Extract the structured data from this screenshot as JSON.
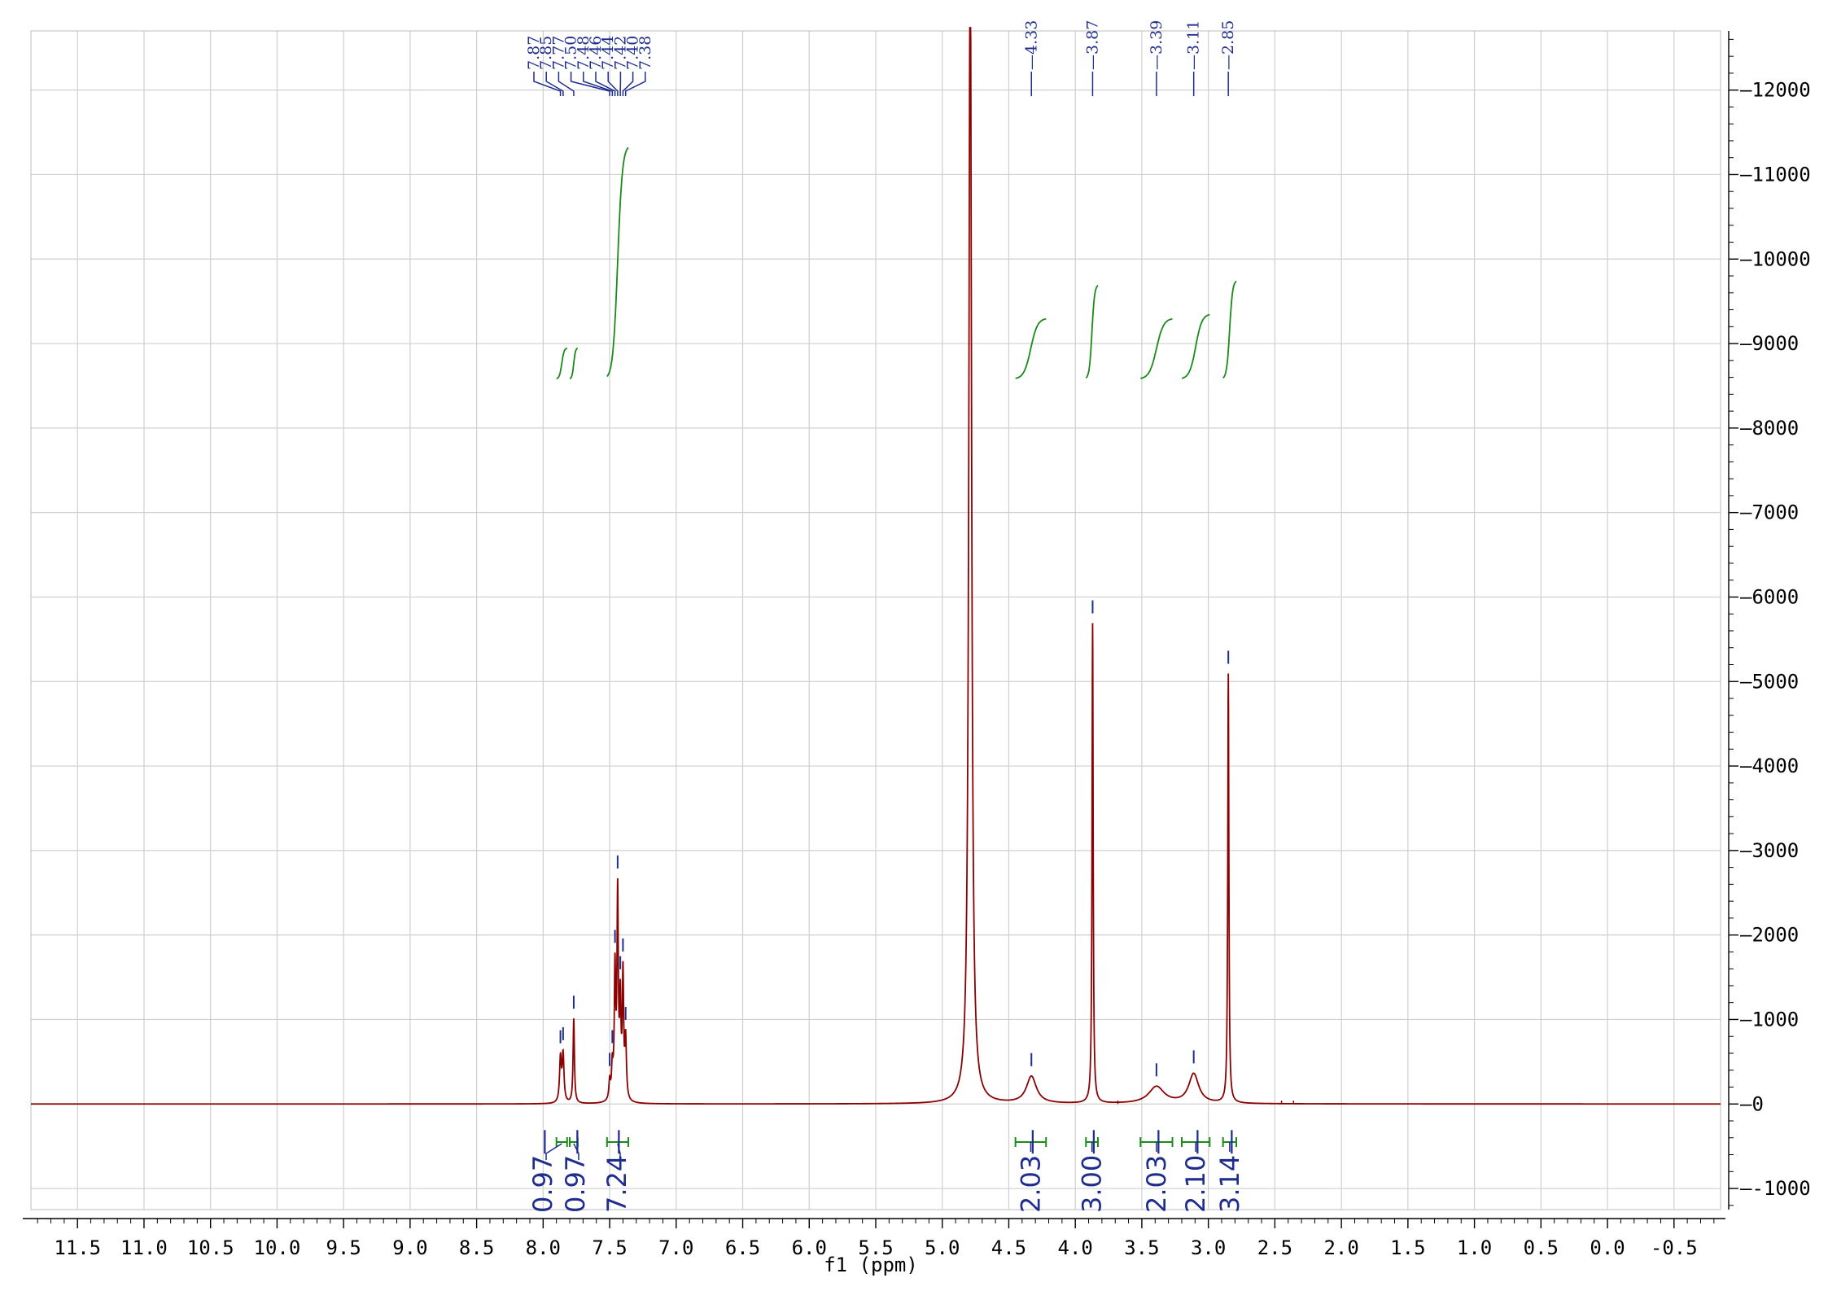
{
  "chart_data": {
    "type": "line",
    "xlabel": "f1 (ppm)",
    "ylabel": "",
    "title": "",
    "xlim": [
      11.85,
      -0.85
    ],
    "ylim": [
      -1250,
      12700
    ],
    "x_reversed": true,
    "grid": true,
    "x_ticks": [
      "11.5",
      "11.0",
      "10.5",
      "10.0",
      "9.5",
      "9.0",
      "8.5",
      "8.0",
      "7.5",
      "7.0",
      "6.5",
      "6.0",
      "5.5",
      "5.0",
      "4.5",
      "4.0",
      "3.5",
      "3.0",
      "2.5",
      "2.0",
      "1.5",
      "1.0",
      "0.5",
      "0.0",
      "-0.5"
    ],
    "y_ticks": [
      "12000",
      "11000",
      "10000",
      "9000",
      "8000",
      "7000",
      "6000",
      "5000",
      "4000",
      "3000",
      "2000",
      "1000",
      "0",
      "-1000"
    ],
    "series": [
      {
        "color": "#8b0000",
        "peaks": [
          {
            "ppm": 7.87,
            "height": 520,
            "width": 0.008
          },
          {
            "ppm": 7.85,
            "height": 560,
            "width": 0.008
          },
          {
            "ppm": 7.77,
            "height": 1000,
            "width": 0.006
          },
          {
            "ppm": 7.5,
            "height": 220,
            "width": 0.007
          },
          {
            "ppm": 7.48,
            "height": 380,
            "width": 0.007
          },
          {
            "ppm": 7.46,
            "height": 1500,
            "width": 0.006
          },
          {
            "ppm": 7.44,
            "height": 2400,
            "width": 0.006
          },
          {
            "ppm": 7.42,
            "height": 1100,
            "width": 0.006
          },
          {
            "ppm": 7.4,
            "height": 1450,
            "width": 0.006
          },
          {
            "ppm": 7.38,
            "height": 700,
            "width": 0.007
          },
          {
            "ppm": 4.79,
            "height": 14000,
            "width": 0.012
          },
          {
            "ppm": 4.33,
            "height": 320,
            "width": 0.045
          },
          {
            "ppm": 3.87,
            "height": 5680,
            "width": 0.005
          },
          {
            "ppm": 3.39,
            "height": 200,
            "width": 0.07
          },
          {
            "ppm": 3.11,
            "height": 350,
            "width": 0.045
          },
          {
            "ppm": 2.85,
            "height": 5080,
            "width": 0.005
          }
        ]
      }
    ],
    "peak_labels": [
      {
        "group": "aromatic",
        "values": [
          "7.87",
          "7.85",
          "7.77",
          "7.50",
          "7.48",
          "7.46",
          "7.44",
          "7.42",
          "7.40",
          "7.38"
        ]
      },
      {
        "group": "single",
        "values": [
          "4.33"
        ]
      },
      {
        "group": "single",
        "values": [
          "3.87"
        ]
      },
      {
        "group": "single",
        "values": [
          "3.39"
        ]
      },
      {
        "group": "single",
        "values": [
          "3.11"
        ]
      },
      {
        "group": "single",
        "values": [
          "2.85"
        ]
      }
    ],
    "integrals": [
      {
        "from": 7.9,
        "to": 7.82,
        "value": "0.97"
      },
      {
        "from": 7.8,
        "to": 7.74,
        "value": "0.97"
      },
      {
        "from": 7.52,
        "to": 7.36,
        "value": "7.24"
      },
      {
        "from": 4.45,
        "to": 4.22,
        "value": "2.03"
      },
      {
        "from": 3.92,
        "to": 3.83,
        "value": "3.00"
      },
      {
        "from": 3.51,
        "to": 3.27,
        "value": "2.03"
      },
      {
        "from": 3.2,
        "to": 2.99,
        "value": "2.10"
      },
      {
        "from": 2.89,
        "to": 2.79,
        "value": "3.14"
      }
    ]
  }
}
